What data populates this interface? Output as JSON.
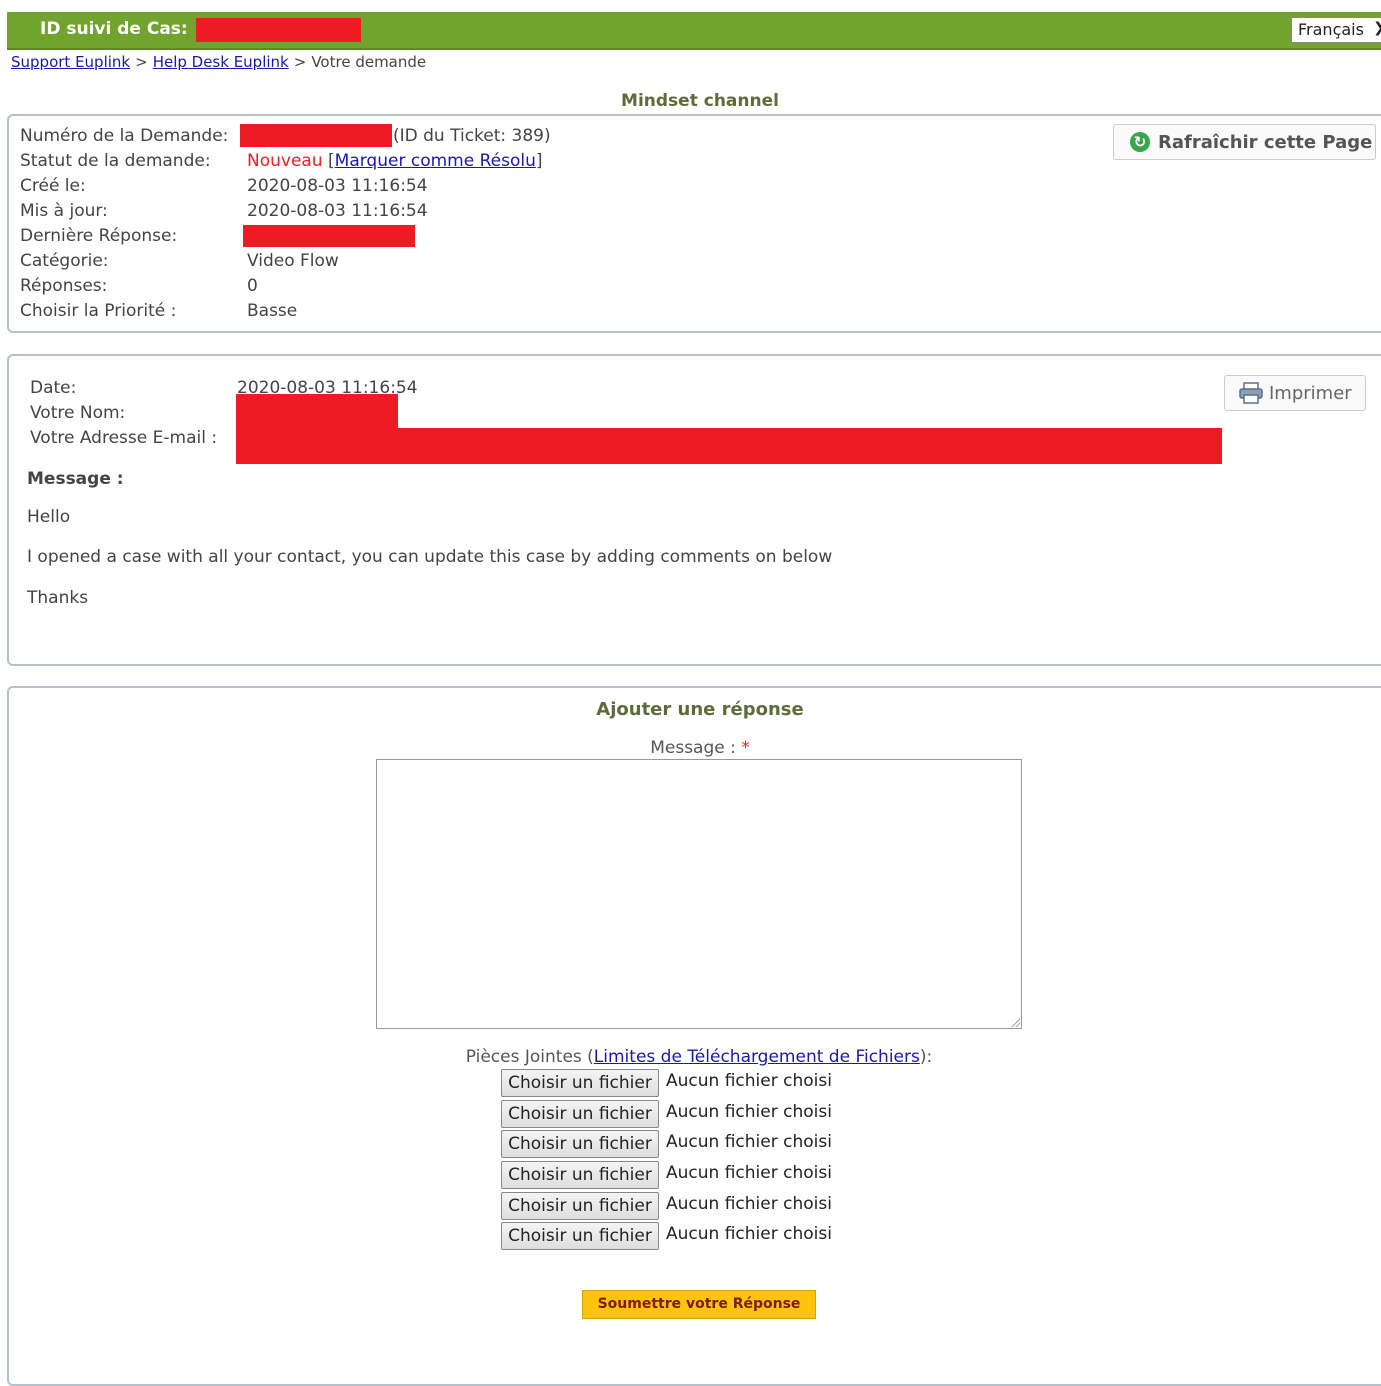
{
  "header": {
    "title": "ID suivi de Cas:",
    "language": "Français"
  },
  "breadcrumb": {
    "items": [
      "Support Euplink",
      "Help Desk Euplink"
    ],
    "current": "Votre demande",
    "separator": ">"
  },
  "channel_title": "Mindset channel",
  "ticket": {
    "number_label": "Numéro de la Demande:",
    "ticket_id_text": "(ID du Ticket: 389)",
    "status_label": "Statut de la demande:",
    "status_value": "Nouveau",
    "mark_resolved_link": "Marquer comme Résolu",
    "created_label": "Créé le:",
    "created_value": "2020-08-03 11:16:54",
    "updated_label": "Mis à jour:",
    "updated_value": "2020-08-03 11:16:54",
    "last_reply_label": "Dernière Réponse:",
    "category_label": "Catégorie:",
    "category_value": "Video Flow",
    "replies_label": "Réponses:",
    "replies_value": "0",
    "priority_label": "Choisir la Priorité :",
    "priority_value": "Basse",
    "refresh_button": "Rafraîchir cette Page"
  },
  "message": {
    "date_label": "Date:",
    "date_value": "2020-08-03 11:16:54",
    "name_label": "Votre Nom:",
    "email_label": "Votre Adresse E-mail :",
    "print_button": "Imprimer",
    "message_label": "Message :",
    "lines": [
      "Hello",
      "I opened a case with all your contact, you can update this case by adding comments on below",
      "Thanks"
    ]
  },
  "reply": {
    "title": "Ajouter une réponse",
    "message_label": "Message :",
    "required_mark": "*",
    "attachments_label": "Pièces Jointes (",
    "attachments_link": "Limites de Téléchargement de Fichiers",
    "attachments_suffix": "):",
    "file_button": "Choisir un fichier",
    "file_none": "Aucun fichier choisi",
    "submit_button": "Soumettre votre Réponse"
  },
  "colors": {
    "topbar": "#72a32f",
    "status_new": "#e8202a",
    "submit": "#fdc30f",
    "redaction": "#ed1c24"
  }
}
